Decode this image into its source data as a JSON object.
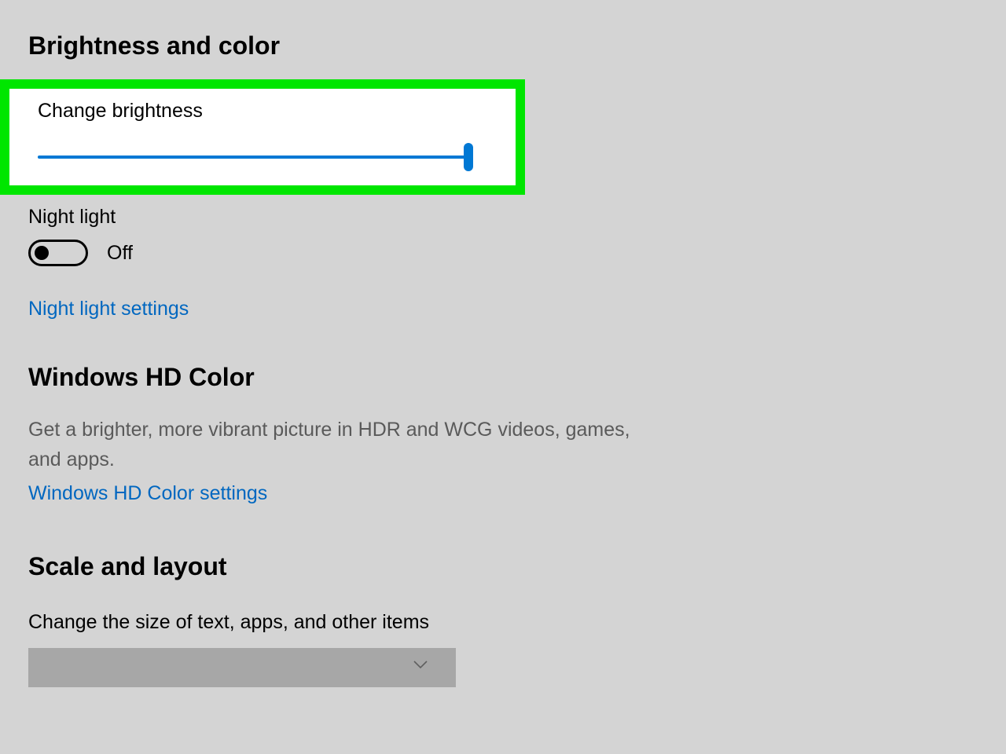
{
  "sections": {
    "brightness_color": {
      "heading": "Brightness and color",
      "change_brightness_label": "Change brightness",
      "brightness_value": 100,
      "night_light_label": "Night light",
      "night_light_state": "Off",
      "night_light_settings_link": "Night light settings"
    },
    "hd_color": {
      "heading": "Windows HD Color",
      "description": "Get a brighter, more vibrant picture in HDR and WCG videos, games, and apps.",
      "settings_link": "Windows HD Color settings"
    },
    "scale_layout": {
      "heading": "Scale and layout",
      "scale_label": "Change the size of text, apps, and other items",
      "scale_selected": ""
    }
  },
  "colors": {
    "accent": "#0078d4",
    "link": "#0067c0",
    "highlight": "#00e600"
  }
}
